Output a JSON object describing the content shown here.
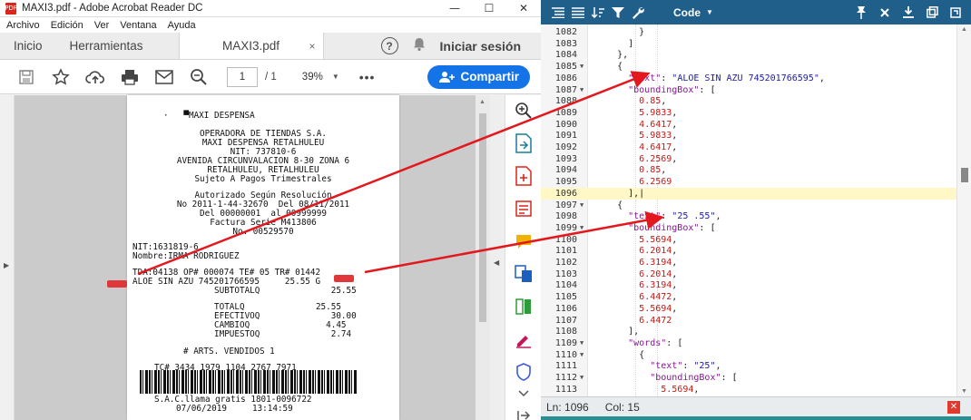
{
  "acrobat": {
    "title": "MAXI3.pdf - Adobe Acrobat Reader DC",
    "file_badge": "PDF",
    "window_controls": [
      "—",
      "☐",
      "✕"
    ],
    "menu": [
      "Archivo",
      "Edición",
      "Ver",
      "Ventana",
      "Ayuda"
    ],
    "tabs": {
      "home": "Inicio",
      "tools": "Herramientas",
      "document": "MAXI3.pdf",
      "close": "×"
    },
    "help_label": "?",
    "signin": "Iniciar sesión",
    "toolbar": {
      "page_current": "1",
      "page_total": "/  1",
      "zoom": "39%",
      "more": "•••",
      "share": "Compartir"
    }
  },
  "receipt": {
    "lines": [
      "·   ▀MAXI DESPENSA",
      "OPERADORA DE TIENDAS S.A.",
      "MAXI DESPENSA RETALHULEU",
      "NIT: 737810-6",
      "AVENIDA CIRCUNVALACION 8-30 ZONA 6",
      "RETALHULEU, RETALHULEU",
      "Sujeto A Pagos Trimestrales",
      "Autorizado Según Resolución",
      "No 2011-1-44-32670  Del 08/11/2011",
      "Del 00000001  al 00999999",
      "Factura Serie M413806",
      "No. 00529570",
      "NIT:1631819-6",
      "Nombre:IRMA RODRIGUEZ",
      "TDA:04138 OP# 000074 TE# 05 TR# 01442",
      "ALOE SIN AZU 745201766595     25.55 G",
      "SUBTOTALQ              25.55",
      "TOTALQ              25.55",
      "EFECTIVOQ              30.00",
      "CAMBIOQ               4.45",
      "IMPUESTOQ              2.74",
      "# ARTS. VENDIDOS 1",
      "TC# 3434 1979 1104 2767 7971",
      "S.A.C.llama gratis 1801-0096722",
      "07/06/2019     13:14:59"
    ]
  },
  "viewer": {
    "code_label": "Code",
    "status": {
      "line": "Ln: 1096",
      "col": "Col: 15"
    },
    "colors": {
      "accent": "#1f5f8a",
      "string": "#1a1aa6",
      "number": "#c41a16",
      "key": "#881391"
    },
    "lines": [
      {
        "n": "1082",
        "fold": false,
        "text": "        }"
      },
      {
        "n": "1083",
        "fold": false,
        "text": "      ]"
      },
      {
        "n": "1084",
        "fold": false,
        "text": "    },"
      },
      {
        "n": "1085",
        "fold": true,
        "text": "    {"
      },
      {
        "n": "1086",
        "fold": false,
        "text": "      \"text\": \"ALOE SIN AZU 745201766595\","
      },
      {
        "n": "1087",
        "fold": true,
        "text": "      \"boundingBox\": ["
      },
      {
        "n": "1088",
        "fold": false,
        "text": "        0.85,"
      },
      {
        "n": "1089",
        "fold": false,
        "text": "        5.9833,"
      },
      {
        "n": "1090",
        "fold": false,
        "text": "        4.6417,"
      },
      {
        "n": "1091",
        "fold": false,
        "text": "        5.9833,"
      },
      {
        "n": "1092",
        "fold": false,
        "text": "        4.6417,"
      },
      {
        "n": "1093",
        "fold": false,
        "text": "        6.2569,"
      },
      {
        "n": "1094",
        "fold": false,
        "text": "        0.85,"
      },
      {
        "n": "1095",
        "fold": false,
        "text": "        6.2569"
      },
      {
        "n": "1096",
        "fold": false,
        "text": "      ],|"
      },
      {
        "n": "1097",
        "fold": true,
        "text": "    {"
      },
      {
        "n": "1098",
        "fold": false,
        "text": "      \"text\": \"25 .55\","
      },
      {
        "n": "1099",
        "fold": true,
        "text": "      \"boundingBox\": ["
      },
      {
        "n": "1100",
        "fold": false,
        "text": "        5.5694,"
      },
      {
        "n": "1101",
        "fold": false,
        "text": "        6.2014,"
      },
      {
        "n": "1102",
        "fold": false,
        "text": "        6.3194,"
      },
      {
        "n": "1103",
        "fold": false,
        "text": "        6.2014,"
      },
      {
        "n": "1104",
        "fold": false,
        "text": "        6.3194,"
      },
      {
        "n": "1105",
        "fold": false,
        "text": "        6.4472,"
      },
      {
        "n": "1106",
        "fold": false,
        "text": "        5.5694,"
      },
      {
        "n": "1107",
        "fold": false,
        "text": "        6.4472"
      },
      {
        "n": "1108",
        "fold": false,
        "text": "      ],"
      },
      {
        "n": "1109",
        "fold": true,
        "text": "      \"words\": ["
      },
      {
        "n": "1110",
        "fold": true,
        "text": "        {"
      },
      {
        "n": "1111",
        "fold": false,
        "text": "          \"text\": \"25\","
      },
      {
        "n": "1112",
        "fold": true,
        "text": "          \"boundingBox\": ["
      },
      {
        "n": "1113",
        "fold": false,
        "text": "            5.5694,"
      }
    ]
  }
}
